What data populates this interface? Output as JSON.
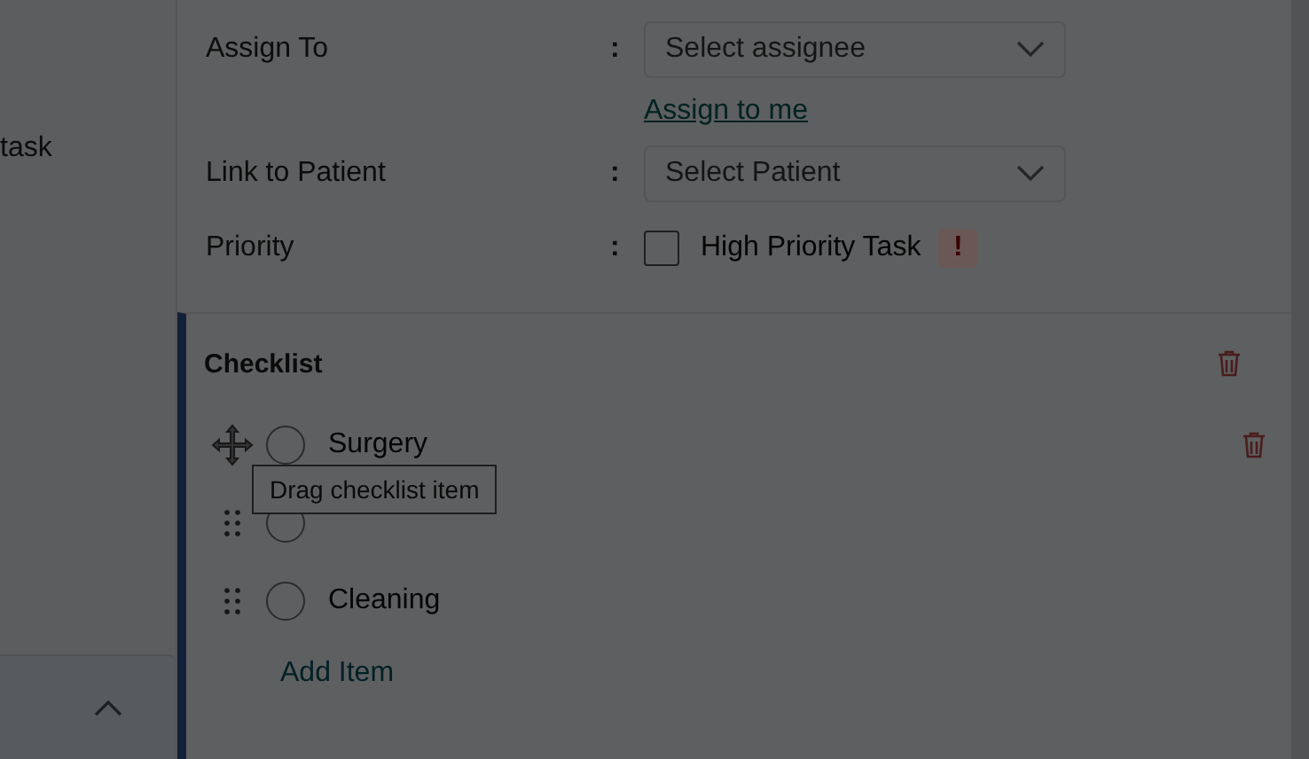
{
  "sidebar": {
    "label": "task",
    "collapse_button": {
      "expanded": true
    }
  },
  "form": {
    "fields": [
      {
        "label": "Assign To",
        "separator": ":",
        "placeholder": "Select assignee",
        "link": "Assign to me"
      },
      {
        "label": "Link to Patient",
        "separator": ":",
        "placeholder": "Select Patient"
      }
    ],
    "priority": {
      "label": "Priority",
      "separator": ":",
      "option": "High Priority Task",
      "checked": false,
      "badge": "!"
    }
  },
  "checklist": {
    "title": "Checklist",
    "items": [
      {
        "label": "Surgery",
        "checked": false,
        "kind": "move"
      },
      {
        "checked": false,
        "kind": "grip"
      },
      {
        "label": "Cleaning",
        "checked": false,
        "kind": "grip"
      }
    ],
    "add_label": "Add Item",
    "tooltip": "Drag checklist item"
  }
}
